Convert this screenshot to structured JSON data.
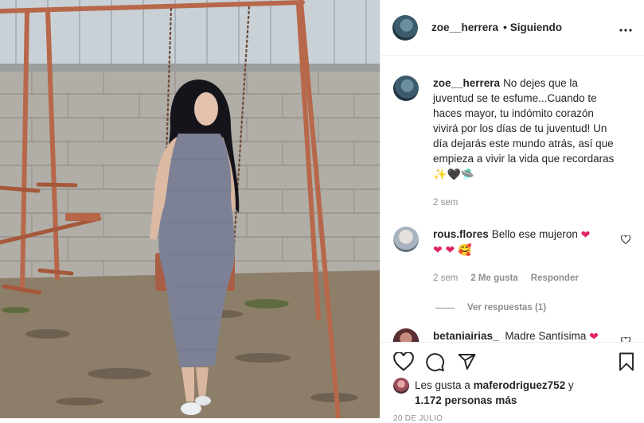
{
  "post": {
    "author": "zoe__herrera",
    "follow_status": "Siguiendo",
    "separator": "•"
  },
  "caption": {
    "username": "zoe__herrera",
    "text": "No dejes que la juventud se te esfume...Cuando te haces mayor, tu indómito corazón vivirá por los días de tu juventud! Un día dejarás este mundo atrás, así que empieza a vivir la vida que recordaras",
    "emoji": [
      "✨",
      "🖤",
      "🛸"
    ],
    "time": "2 sem"
  },
  "comments": [
    {
      "username": "rous.flores",
      "text": "Bello ese mujeron",
      "emoji_inline": "❤",
      "emoji_line2": [
        "❤",
        "❤",
        "🥰"
      ],
      "time": "2 sem",
      "likes": "2 Me gusta",
      "reply_label": "Responder",
      "view_replies": "Ver respuestas (1)"
    },
    {
      "username": "betaniairias_",
      "text": "Madre Santísima",
      "emoji_inline": "❤",
      "emoji_line2": [
        "🔥"
      ]
    }
  ],
  "likes": {
    "prefix": "Les gusta a",
    "user": "maferodriguez752",
    "conj": "y",
    "others": "1.172 personas más"
  },
  "date": "20 DE JULIO",
  "icons": [
    "more-icon",
    "heart-icon",
    "comment-icon",
    "share-icon",
    "bookmark-icon"
  ],
  "colors": {
    "text": "#262626",
    "secondary": "#8e8e8e",
    "heart": "#ed4956",
    "border": "#efefef"
  }
}
